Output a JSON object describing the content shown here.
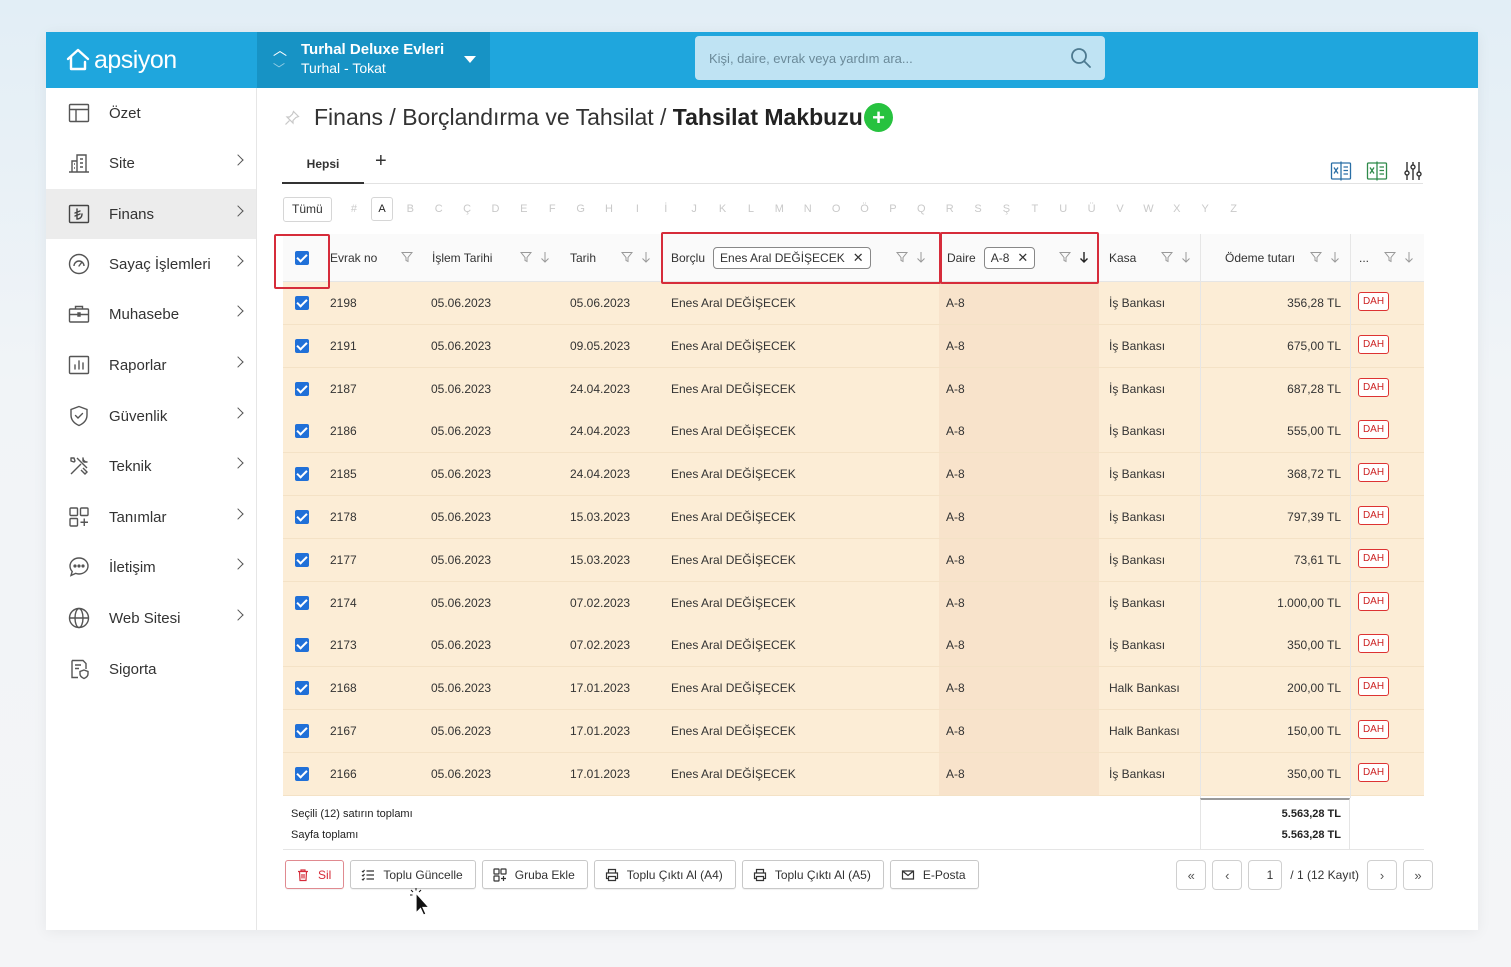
{
  "header": {
    "logo_text": "apsiyon",
    "site_name": "Turhal Deluxe Evleri",
    "site_location": "Turhal - Tokat",
    "search_placeholder": "Kişi, daire, evrak veya yardım ara..."
  },
  "sidebar": {
    "items": [
      {
        "label": "Özet",
        "icon": "table-icon",
        "has_arrow": false
      },
      {
        "label": "Site",
        "icon": "building-icon",
        "has_arrow": true
      },
      {
        "label": "Finans",
        "icon": "lira-icon",
        "has_arrow": true,
        "active": true
      },
      {
        "label": "Sayaç İşlemleri",
        "icon": "gauge-icon",
        "has_arrow": true
      },
      {
        "label": "Muhasebe",
        "icon": "briefcase-icon",
        "has_arrow": true
      },
      {
        "label": "Raporlar",
        "icon": "bar-chart-icon",
        "has_arrow": true
      },
      {
        "label": "Güvenlik",
        "icon": "shield-icon",
        "has_arrow": true
      },
      {
        "label": "Teknik",
        "icon": "tools-icon",
        "has_arrow": true
      },
      {
        "label": "Tanımlar",
        "icon": "grid-plus-icon",
        "has_arrow": true
      },
      {
        "label": "İletişim",
        "icon": "chat-icon",
        "has_arrow": true
      },
      {
        "label": "Web Sitesi",
        "icon": "globe-icon",
        "has_arrow": true
      },
      {
        "label": "Sigorta",
        "icon": "insurance-doc-icon",
        "has_arrow": false
      }
    ]
  },
  "page": {
    "breadcrumb_prefix": "Finans / Borçlandırma ve Tahsilat / ",
    "title": "Tahsilat Makbuzu",
    "add_label": "+",
    "tab_active": "Hepsi",
    "tab_add": "+"
  },
  "alpha_filter": {
    "all_label": "Tümü",
    "letters": [
      "#",
      "A",
      "B",
      "C",
      "Ç",
      "D",
      "E",
      "F",
      "G",
      "H",
      "I",
      "İ",
      "J",
      "K",
      "L",
      "M",
      "N",
      "O",
      "Ö",
      "P",
      "Q",
      "R",
      "S",
      "Ş",
      "T",
      "U",
      "Ü",
      "V",
      "W",
      "X",
      "Y",
      "Z"
    ],
    "selected": "A"
  },
  "table": {
    "columns": {
      "evrak_no": "Evrak no",
      "islem_tarihi": "İşlem Tarihi",
      "tarih": "Tarih",
      "borclu": "Borçlu",
      "daire": "Daire",
      "kasa": "Kasa",
      "odeme_tutari": "Ödeme tutarı",
      "more": "..."
    },
    "filters": {
      "borclu": "Enes Aral DEĞİŞECEK",
      "daire": "A-8"
    },
    "rows": [
      {
        "evrak": "2198",
        "islem": "05.06.2023",
        "tarih": "05.06.2023",
        "borclu": "Enes Aral DEĞİŞECEK",
        "daire": "A-8",
        "kasa": "İş Bankası",
        "tutar": "356,28 TL",
        "tag": "DAH"
      },
      {
        "evrak": "2191",
        "islem": "05.06.2023",
        "tarih": "09.05.2023",
        "borclu": "Enes Aral DEĞİŞECEK",
        "daire": "A-8",
        "kasa": "İş Bankası",
        "tutar": "675,00 TL",
        "tag": "DAH"
      },
      {
        "evrak": "2187",
        "islem": "05.06.2023",
        "tarih": "24.04.2023",
        "borclu": "Enes Aral DEĞİŞECEK",
        "daire": "A-8",
        "kasa": "İş Bankası",
        "tutar": "687,28 TL",
        "tag": "DAH"
      },
      {
        "evrak": "2186",
        "islem": "05.06.2023",
        "tarih": "24.04.2023",
        "borclu": "Enes Aral DEĞİŞECEK",
        "daire": "A-8",
        "kasa": "İş Bankası",
        "tutar": "555,00 TL",
        "tag": "DAH"
      },
      {
        "evrak": "2185",
        "islem": "05.06.2023",
        "tarih": "24.04.2023",
        "borclu": "Enes Aral DEĞİŞECEK",
        "daire": "A-8",
        "kasa": "İş Bankası",
        "tutar": "368,72 TL",
        "tag": "DAH"
      },
      {
        "evrak": "2178",
        "islem": "05.06.2023",
        "tarih": "15.03.2023",
        "borclu": "Enes Aral DEĞİŞECEK",
        "daire": "A-8",
        "kasa": "İş Bankası",
        "tutar": "797,39 TL",
        "tag": "DAH"
      },
      {
        "evrak": "2177",
        "islem": "05.06.2023",
        "tarih": "15.03.2023",
        "borclu": "Enes Aral DEĞİŞECEK",
        "daire": "A-8",
        "kasa": "İş Bankası",
        "tutar": "73,61 TL",
        "tag": "DAH"
      },
      {
        "evrak": "2174",
        "islem": "05.06.2023",
        "tarih": "07.02.2023",
        "borclu": "Enes Aral DEĞİŞECEK",
        "daire": "A-8",
        "kasa": "İş Bankası",
        "tutar": "1.000,00 TL",
        "tag": "DAH"
      },
      {
        "evrak": "2173",
        "islem": "05.06.2023",
        "tarih": "07.02.2023",
        "borclu": "Enes Aral DEĞİŞECEK",
        "daire": "A-8",
        "kasa": "İş Bankası",
        "tutar": "350,00 TL",
        "tag": "DAH"
      },
      {
        "evrak": "2168",
        "islem": "05.06.2023",
        "tarih": "17.01.2023",
        "borclu": "Enes Aral DEĞİŞECEK",
        "daire": "A-8",
        "kasa": "Halk Bankası",
        "tutar": "200,00 TL",
        "tag": "DAH"
      },
      {
        "evrak": "2167",
        "islem": "05.06.2023",
        "tarih": "17.01.2023",
        "borclu": "Enes Aral DEĞİŞECEK",
        "daire": "A-8",
        "kasa": "Halk Bankası",
        "tutar": "150,00 TL",
        "tag": "DAH"
      },
      {
        "evrak": "2166",
        "islem": "05.06.2023",
        "tarih": "17.01.2023",
        "borclu": "Enes Aral DEĞİŞECEK",
        "daire": "A-8",
        "kasa": "İş Bankası",
        "tutar": "350,00 TL",
        "tag": "DAH"
      }
    ],
    "totals": {
      "selected_label": "Seçili (12) satırın toplamı",
      "selected_value": "5.563,28 TL",
      "page_label": "Sayfa toplamı",
      "page_value": "5.563,28 TL"
    }
  },
  "actions": {
    "delete": "Sil",
    "bulk_update": "Toplu Güncelle",
    "add_group": "Gruba Ekle",
    "print_a4": "Toplu Çıktı Al (A4)",
    "print_a5": "Toplu Çıktı Al (A5)",
    "email": "E-Posta"
  },
  "pagination": {
    "current_page": "1",
    "summary": "/ 1 (12 Kayıt)"
  },
  "colors": {
    "brand": "#1fa6dd",
    "brand_dark": "#1793c5",
    "row_selected": "#fcedd6",
    "highlight_red": "#d62c3a",
    "add_green": "#27c23f",
    "checkbox_blue": "#2070d8"
  }
}
